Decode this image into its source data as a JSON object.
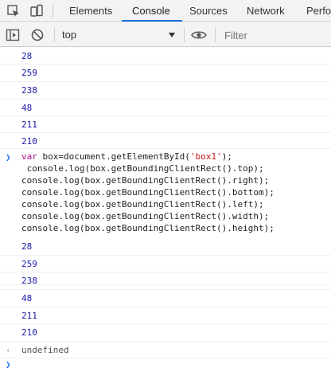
{
  "tabs": {
    "elements": "Elements",
    "console": "Console",
    "sources": "Sources",
    "network": "Network",
    "performance": "Perfo"
  },
  "toolbar": {
    "context": "top",
    "filter_placeholder": "Filter"
  },
  "console": {
    "prev_outputs": [
      "28",
      "259",
      "238",
      "48",
      "211",
      "210"
    ],
    "code": {
      "line1_kw": "var",
      "line1_pre": " box=document.getElementById(",
      "line1_str": "'box1'",
      "line1_post": ");",
      "lines": [
        " console.log(box.getBoundingClientRect().top);",
        "console.log(box.getBoundingClientRect().right);",
        "console.log(box.getBoundingClientRect().bottom);",
        "console.log(box.getBoundingClientRect().left);",
        "console.log(box.getBoundingClientRect().width);",
        "console.log(box.getBoundingClientRect().height);"
      ]
    },
    "outputs": [
      "28",
      "259",
      "238",
      "48",
      "211",
      "210"
    ],
    "return_value": "undefined"
  }
}
